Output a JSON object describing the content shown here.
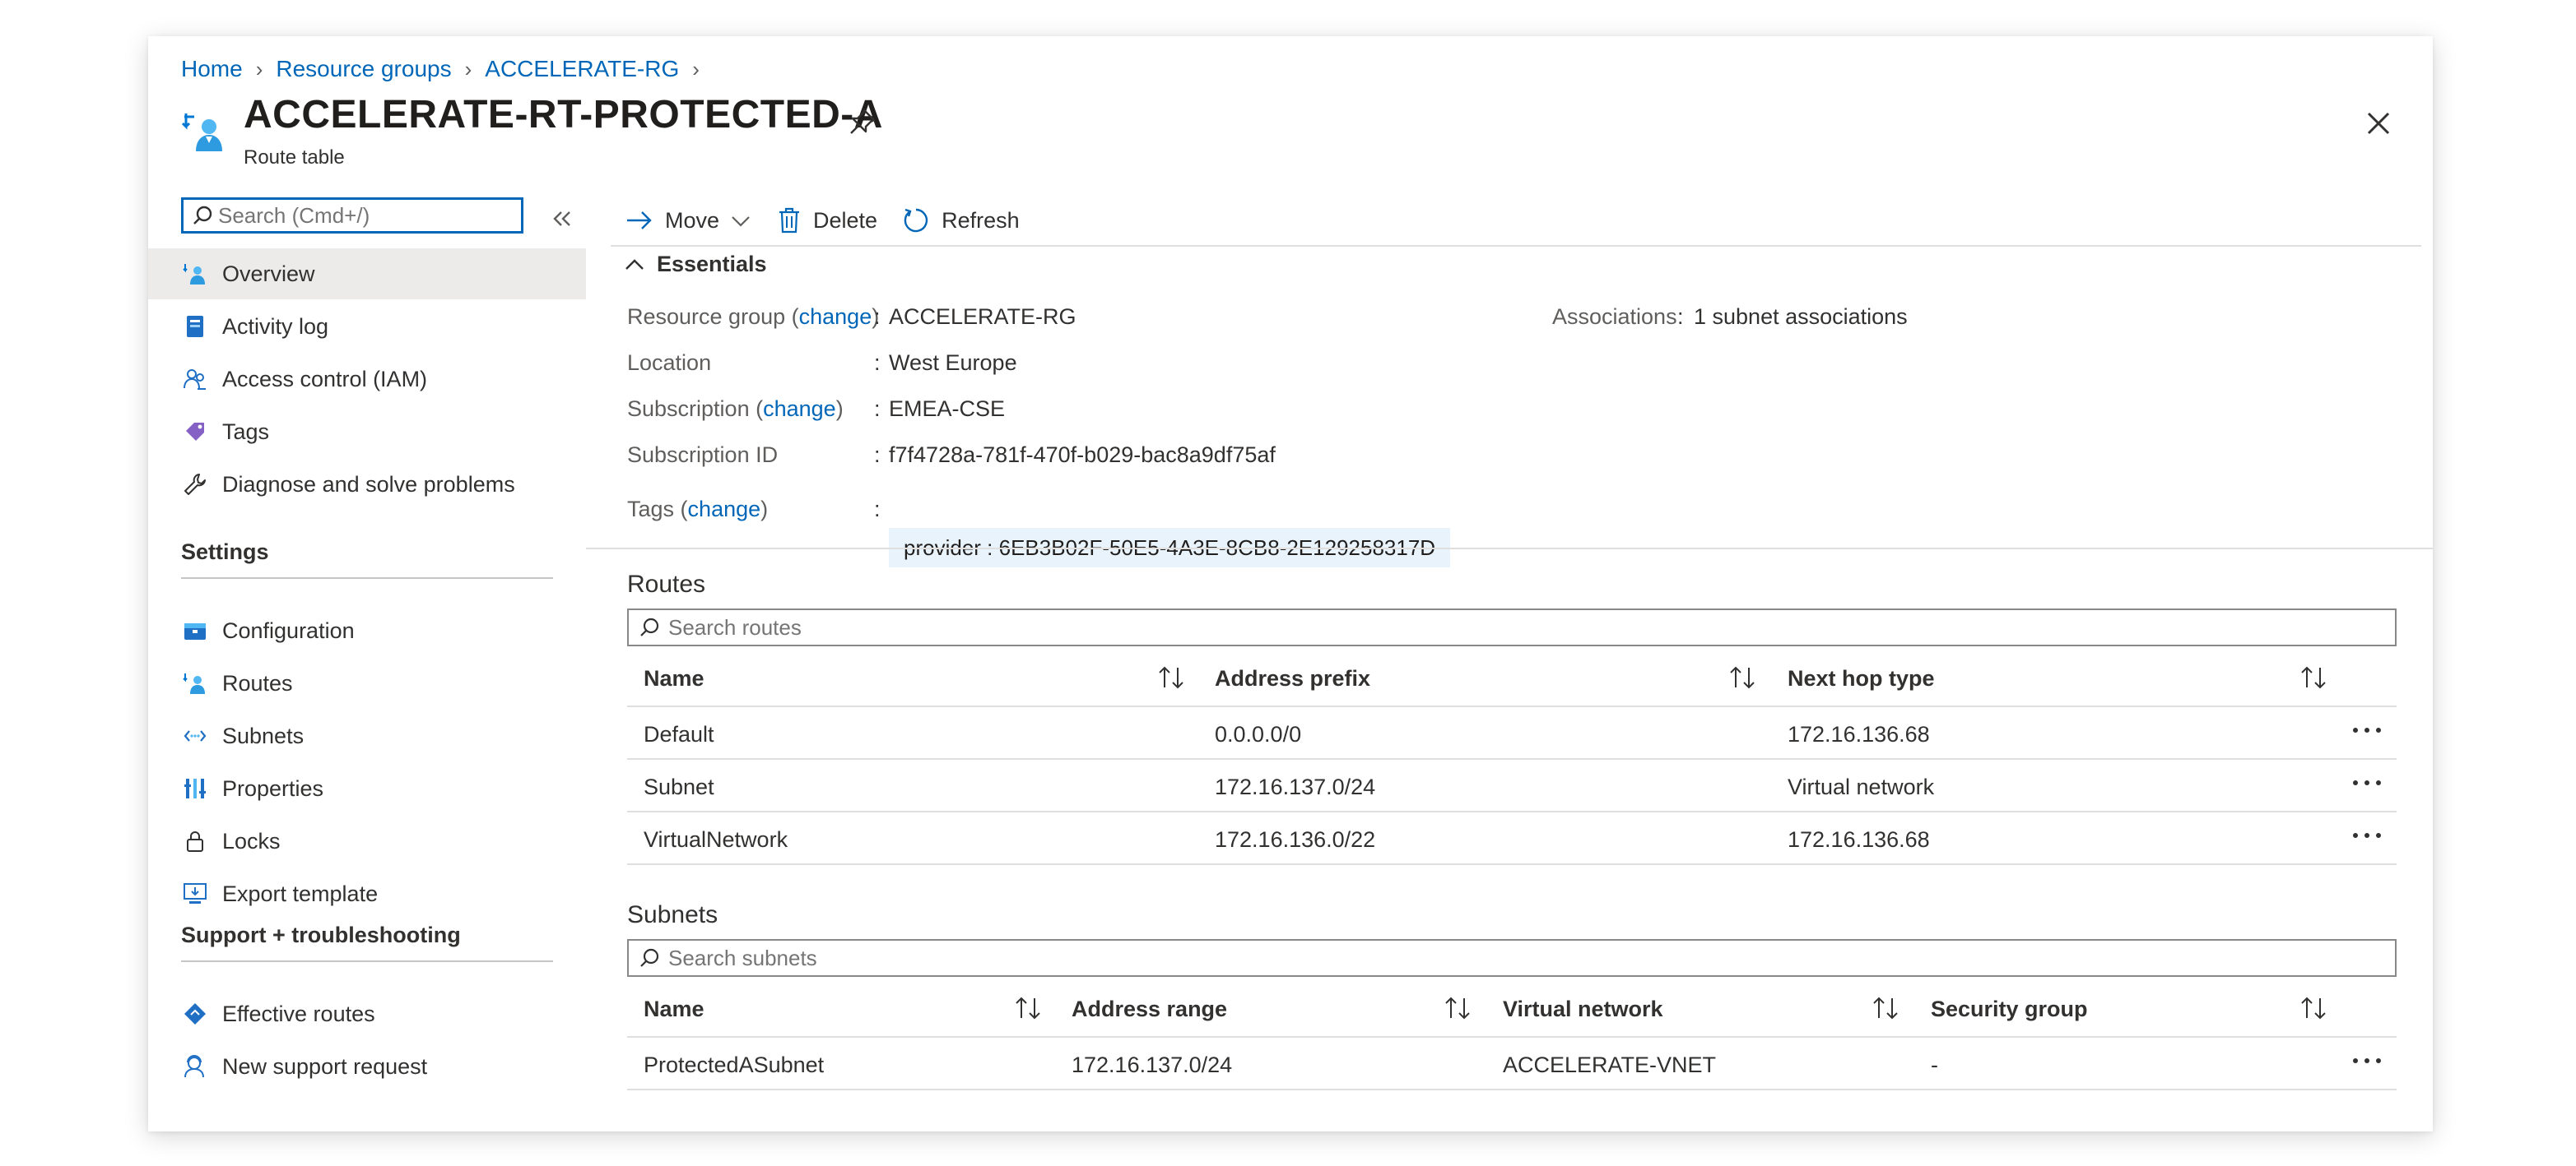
{
  "breadcrumb": {
    "home": "Home",
    "resource_groups": "Resource groups",
    "rg": "ACCELERATE-RG"
  },
  "header": {
    "title": "ACCELERATE-RT-PROTECTED-A",
    "subtitle": "Route table"
  },
  "nav": {
    "search_placeholder": "Search (Cmd+/)",
    "items": [
      {
        "label": "Overview",
        "icon": "overview-icon"
      },
      {
        "label": "Activity log",
        "icon": "activity-log-icon"
      },
      {
        "label": "Access control (IAM)",
        "icon": "iam-icon"
      },
      {
        "label": "Tags",
        "icon": "tag-icon"
      },
      {
        "label": "Diagnose and solve problems",
        "icon": "wrench-icon"
      }
    ],
    "settings_header": "Settings",
    "settings_items": [
      {
        "label": "Configuration",
        "icon": "configuration-icon"
      },
      {
        "label": "Routes",
        "icon": "routes-icon"
      },
      {
        "label": "Subnets",
        "icon": "subnets-icon"
      },
      {
        "label": "Properties",
        "icon": "properties-icon"
      },
      {
        "label": "Locks",
        "icon": "lock-icon"
      },
      {
        "label": "Export template",
        "icon": "export-template-icon"
      }
    ],
    "support_header": "Support + troubleshooting",
    "support_items": [
      {
        "label": "Effective routes",
        "icon": "effective-routes-icon"
      },
      {
        "label": "New support request",
        "icon": "support-request-icon"
      }
    ]
  },
  "toolbar": {
    "move": "Move",
    "delete": "Delete",
    "refresh": "Refresh"
  },
  "essentials": {
    "toggle": "Essentials",
    "change": "change",
    "resource_group_label": "Resource group",
    "resource_group_value": "ACCELERATE-RG",
    "location_label": "Location",
    "location_value": "West Europe",
    "subscription_label": "Subscription",
    "subscription_value": "EMEA-CSE",
    "subscription_id_label": "Subscription ID",
    "subscription_id_value": "f7f4728a-781f-470f-b029-bac8a9df75af",
    "tags_label": "Tags",
    "tag_value": "provider : 6EB3B02F-50E5-4A3E-8CB8-2E129258317D",
    "associations_label": "Associations",
    "associations_value": "1 subnet associations"
  },
  "routes": {
    "title": "Routes",
    "search_placeholder": "Search routes",
    "columns": [
      "Name",
      "Address prefix",
      "Next hop type"
    ],
    "rows": [
      [
        "Default",
        "0.0.0.0/0",
        "172.16.136.68"
      ],
      [
        "Subnet",
        "172.16.137.0/24",
        "Virtual network"
      ],
      [
        "VirtualNetwork",
        "172.16.136.0/22",
        "172.16.136.68"
      ]
    ]
  },
  "subnets": {
    "title": "Subnets",
    "search_placeholder": "Search subnets",
    "columns": [
      "Name",
      "Address range",
      "Virtual network",
      "Security group"
    ],
    "rows": [
      [
        "ProtectedASubnet",
        "172.16.137.0/24",
        "ACCELERATE-VNET",
        "-"
      ]
    ]
  },
  "colors": {
    "accent": "#0067b8",
    "active_nav": "#edebe9",
    "tag_chip": "#e8f3fc"
  }
}
